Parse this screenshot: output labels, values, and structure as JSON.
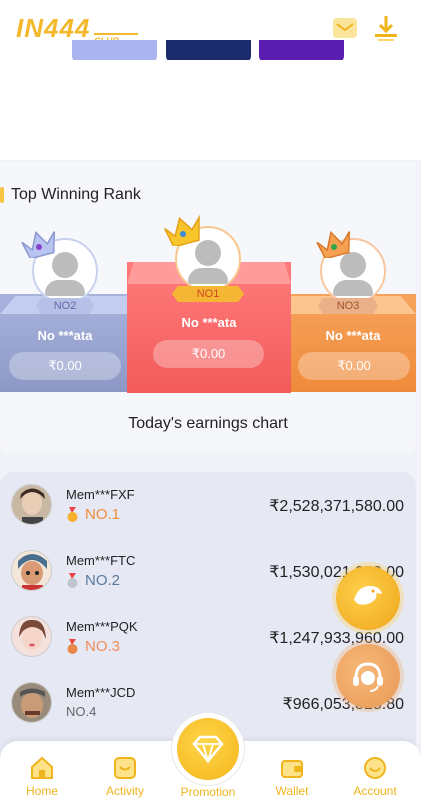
{
  "header": {
    "logo_main": "IN444",
    "logo_sub": "CLUB"
  },
  "colors": {
    "accent": "#f0b41d",
    "rank1": "#f35b5b",
    "rank2": "#8d98c6",
    "rank3": "#ef8a3a",
    "tab1": "#aab4ee",
    "tab2": "#1b2a6b",
    "tab3": "#5a1fb0"
  },
  "rank": {
    "title": "Top Winning Rank",
    "podium": [
      {
        "tag": "NO1",
        "name": "No ***ata",
        "amount": "₹0.00"
      },
      {
        "tag": "NO2",
        "name": "No ***ata",
        "amount": "₹0.00"
      },
      {
        "tag": "NO3",
        "name": "No ***ata",
        "amount": "₹0.00"
      }
    ],
    "caption": "Today's earnings chart"
  },
  "list": [
    {
      "name": "Mem***FXF",
      "rank": "NO.1",
      "value": "₹2,528,371,580.00",
      "rank_color": "#f08c3a"
    },
    {
      "name": "Mem***FTC",
      "rank": "NO.2",
      "value": "₹1,530,021,000.00",
      "rank_color": "#5a7a9c"
    },
    {
      "name": "Mem***PQK",
      "rank": "NO.3",
      "value": "₹1,247,933,960.00",
      "rank_color": "#f08c5a"
    },
    {
      "name": "Mem***JCD",
      "rank": "NO.4",
      "value": "₹966,053,825.80",
      "rank_color": "#666666"
    }
  ],
  "nav": {
    "home": "Home",
    "activity": "Activity",
    "promotion": "Promotion",
    "wallet": "Wallet",
    "account": "Account"
  }
}
